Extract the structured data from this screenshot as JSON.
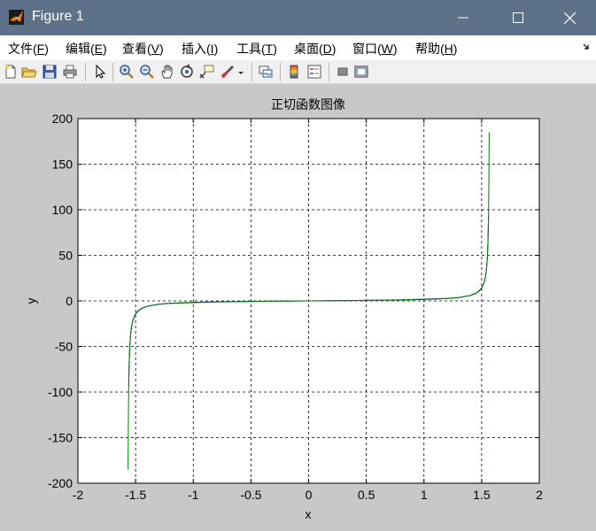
{
  "window": {
    "title": "Figure 1",
    "controls": {
      "minimize": "minimize",
      "maximize": "maximize",
      "close": "close"
    }
  },
  "menu": {
    "items": [
      {
        "label": "文件",
        "key": "F"
      },
      {
        "label": "编辑",
        "key": "E"
      },
      {
        "label": "查看",
        "key": "V"
      },
      {
        "label": "插入",
        "key": "I"
      },
      {
        "label": "工具",
        "key": "T"
      },
      {
        "label": "桌面",
        "key": "D"
      },
      {
        "label": "窗口",
        "key": "W"
      },
      {
        "label": "帮助",
        "key": "H"
      }
    ]
  },
  "toolbar": {
    "buttons": [
      "new-figure-icon",
      "open-file-icon",
      "save-icon",
      "print-icon",
      "pointer-icon",
      "zoom-in-icon",
      "zoom-out-icon",
      "pan-hand-icon",
      "rotate-3d-icon",
      "data-cursor-icon",
      "brush-icon",
      "brush-dropdown-icon",
      "link-plot-icon",
      "insert-colorbar-icon",
      "insert-legend-icon",
      "hide-plot-tools-icon",
      "show-plot-tools-icon"
    ]
  },
  "chart_data": {
    "type": "line",
    "title": "正切函数图像",
    "xlabel": "x",
    "ylabel": "y",
    "xlim": [
      -2,
      2
    ],
    "ylim": [
      -200,
      200
    ],
    "xticks": [
      -2,
      -1.5,
      -1,
      -0.5,
      0,
      0.5,
      1,
      1.5,
      2
    ],
    "yticks": [
      -200,
      -150,
      -100,
      -50,
      0,
      50,
      100,
      150,
      200
    ],
    "xtick_labels": [
      "-2",
      "-1.5",
      "-1",
      "-0.5",
      "0",
      "0.5",
      "1",
      "1.5",
      "2"
    ],
    "ytick_labels": [
      "-200",
      "-150",
      "-100",
      "-50",
      "0",
      "50",
      "100",
      "150",
      "200"
    ],
    "grid": true,
    "grid_style": "dashed",
    "series": [
      {
        "color": "#0000aa",
        "x": [
          -1.56,
          -1.555,
          -1.55,
          -1.54,
          -1.53,
          -1.52,
          -1.5,
          -1.48,
          -1.45,
          -1.4,
          -1.3,
          -1.2,
          -1.0,
          -0.8,
          -0.6,
          -0.4,
          -0.2,
          0,
          0.2,
          0.4,
          0.6,
          0.8,
          1.0,
          1.2,
          1.3,
          1.4,
          1.45,
          1.48,
          1.5,
          1.52,
          1.53,
          1.54,
          1.55,
          1.555,
          1.56
        ],
        "y": [
          -92.6,
          -64.4,
          -48.1,
          -32.5,
          -24.5,
          -19.7,
          -14.1,
          -11.0,
          -8.2,
          -5.8,
          -3.6,
          -2.6,
          -1.6,
          -1.0,
          -0.7,
          -0.4,
          -0.2,
          0,
          0.2,
          0.4,
          0.7,
          1.0,
          1.6,
          2.6,
          3.6,
          5.8,
          8.2,
          11.0,
          14.1,
          19.7,
          24.5,
          32.5,
          48.1,
          64.4,
          92.6
        ]
      },
      {
        "color": "#008000",
        "x": [
          -1.5654,
          -1.563,
          -1.56,
          -1.555,
          -1.55,
          -1.545,
          -1.54,
          -1.53,
          -1.52,
          -1.51,
          -1.5,
          -1.48,
          -1.45,
          -1.4,
          -1.3,
          -1.2,
          -1.0,
          -0.8,
          -0.6,
          -0.4,
          -0.2,
          0,
          0.2,
          0.4,
          0.6,
          0.8,
          1.0,
          1.2,
          1.3,
          1.4,
          1.45,
          1.48,
          1.5,
          1.51,
          1.52,
          1.53,
          1.54,
          1.545,
          1.55,
          1.555,
          1.56,
          1.563,
          1.5654
        ],
        "y": [
          -185,
          -138,
          -96,
          -66,
          -49,
          -39,
          -33,
          -25,
          -20,
          -16.5,
          -14.5,
          -11.5,
          -8.5,
          -6,
          -3.8,
          -2.8,
          -1.9,
          -1.2,
          -0.8,
          -0.5,
          -0.25,
          0,
          0.25,
          0.5,
          0.8,
          1.2,
          1.9,
          2.8,
          3.8,
          6,
          8.5,
          11.5,
          14.5,
          16.5,
          20,
          25,
          33,
          39,
          49,
          66,
          96,
          138,
          185
        ]
      }
    ]
  }
}
